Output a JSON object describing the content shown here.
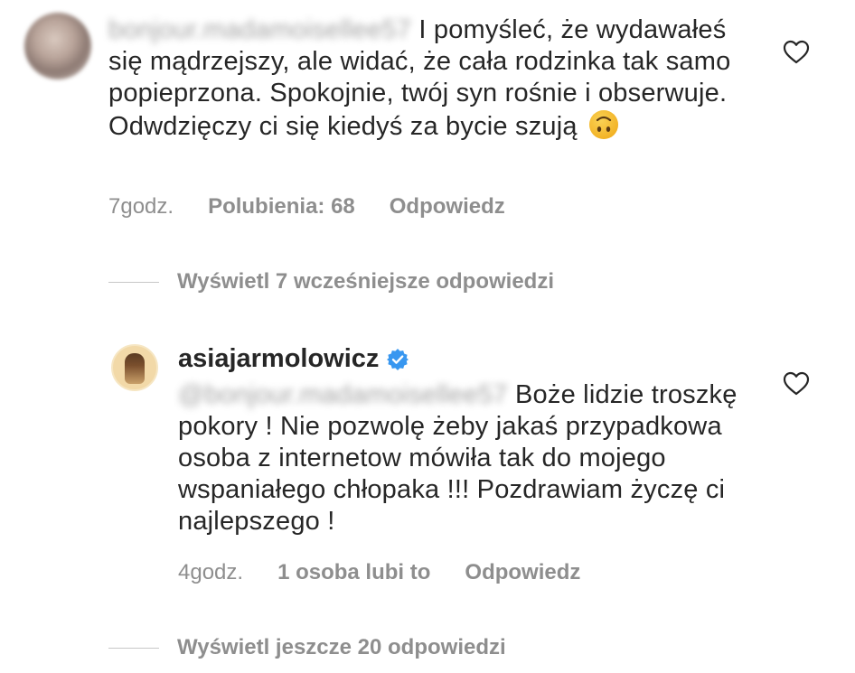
{
  "comment": {
    "username": "bonjour.madamoisellee57",
    "text": "I pomyśleć, że wydawałeś się mądrzejszy, ale widać, że cała rodzinka tak samo popieprzona. Spokojnie, twój syn rośnie i obserwuje. Odwdzięczy ci się kiedyś za bycie szują",
    "emoji": "upside-down-face",
    "time": "7godz.",
    "likes": "Polubienia: 68",
    "reply_label": "Odpowiedz"
  },
  "view_previous_replies": "Wyświetl 7 wcześniejsze odpowiedzi",
  "reply": {
    "username": "asiajarmolowicz",
    "verified": true,
    "mention": "@bonjour.madamoisellee57",
    "text": "Boże lidzie troszkę pokory ! Nie pozwolę żeby jakaś przypadkowa osoba z internetow mówiła tak do mojego wspaniałego chłopaka !!! Pozdrawiam życzę ci najlepszego !",
    "time": "4godz.",
    "likes": "1 osoba lubi to",
    "reply_label": "Odpowiedz"
  },
  "view_more_replies": "Wyświetl jeszcze 20 odpowiedzi",
  "colors": {
    "text": "#262626",
    "secondary": "#8e8e8e",
    "verified": "#3897f0",
    "emoji": "#f7c02c"
  }
}
